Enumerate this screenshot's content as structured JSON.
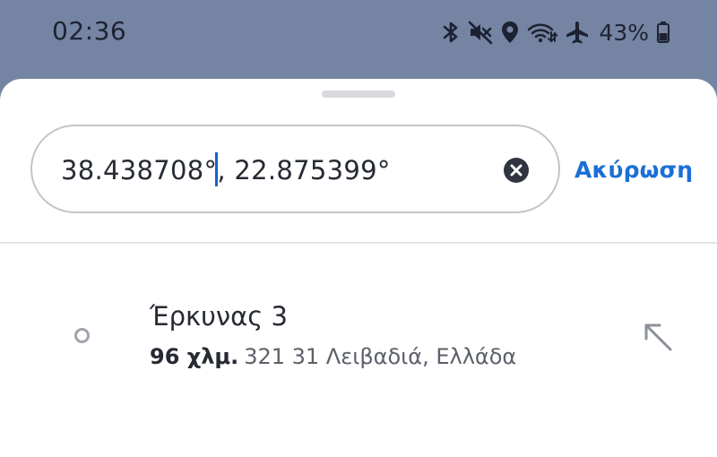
{
  "status_bar": {
    "time": "02:36",
    "battery_percent": "43%",
    "icons": [
      "bluetooth-icon",
      "mute-icon",
      "location-icon",
      "wifi-icon",
      "airplane-icon",
      "battery-icon"
    ]
  },
  "search": {
    "value_before_caret": "38.438708°",
    "value_after_caret": ", 22.875399°",
    "clear_icon": "close-circle-icon",
    "cancel_label": "Ακύρωση"
  },
  "results": [
    {
      "title": "Έρκυνας 3",
      "distance": "96 χλμ.",
      "address": "321 31 Λειβαδιά, Ελλάδα",
      "icon": "place-dot-icon",
      "action_icon": "north-west-arrow-icon"
    }
  ],
  "colors": {
    "status_bar_bg": "#7584a2",
    "accent": "#1a6fd6",
    "text_primary": "#262a33",
    "text_secondary": "#5c6069"
  }
}
